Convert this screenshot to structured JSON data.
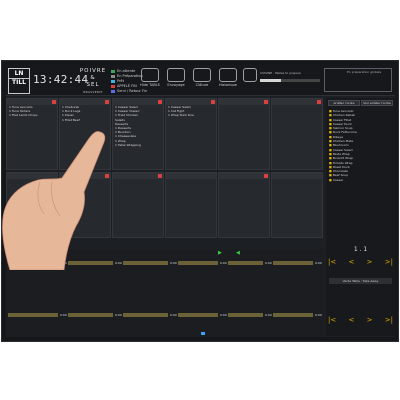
{
  "header": {
    "logo_top": "LN",
    "logo_bottom": "TILL",
    "clock": "13:42:44",
    "restaurant": [
      "POIVRE",
      "&",
      "SEL"
    ],
    "restaurant_sub": "BRASSERIE",
    "legend": [
      {
        "label": "En attente",
        "color": "#3aa757"
      },
      {
        "label": "En Préparation",
        "color": "#8a8a8a"
      },
      {
        "label": "Prêt",
        "color": "#3fb0e0"
      },
      {
        "label": "APPELÉ FIN",
        "color": "#d94040"
      },
      {
        "label": "Servi / Retour Fin",
        "color": "#5a6df0"
      }
    ],
    "tools": [
      "Hide TABLE",
      "Envoyage",
      "Clôture",
      "Historique",
      "Gestion des plats"
    ],
    "current_label": "CUISINE",
    "progress_caption": "Tables to prepare",
    "progress": 0.35,
    "box_caption": "En préparation globale"
  },
  "tiles": [
    {
      "lines": [
        "1 Tuna Avocado",
        "1 Tuna Tartare",
        "1 Filet Lamb Chops"
      ]
    },
    {
      "lines": [
        "1 Cheburek",
        "1 Duck Legs",
        "1 Kissel",
        "1 Fillet Beef"
      ]
    },
    {
      "lines": [
        "1 Caesar Salad",
        "1 Caesar Classic",
        "1 Fried Chicken",
        "Salads",
        "Desserts",
        "1 Desserts",
        "1 Bourbon",
        "1 Cheesecake",
        "1 Wrap",
        "1 Table Wrapping"
      ]
    },
    {
      "lines": [
        "1 Caesar Salad",
        "1 Cat Fight",
        "1 Wrap Stick Doe"
      ]
    },
    {
      "lines": []
    },
    {
      "lines": []
    }
  ],
  "right_panel": {
    "btn_left": "Arrêter l'ordre",
    "btn_right": "Voir arrêter l'ordre",
    "items": [
      "Tuna Avocado",
      "Chicken Kebab",
      "Caesar Fillet",
      "Caesar Duck",
      "Salmon Soup",
      "Duck Fettuccine",
      "Ribeye",
      "Chicken Plate",
      "Mushroom",
      "Caesar Salad",
      "Pasta Wrap",
      "Borscht Wrap",
      "Tomato Wrap",
      "Roast Duck",
      "Chocolate",
      "Beef Soup",
      "Caesar"
    ],
    "page_label": "1 . 1",
    "arrow_left": "|<",
    "arrow_prev": "<",
    "arrow_next": ">",
    "arrow_right": ">|",
    "bottom_bar": "Vente Table : Take Away"
  },
  "take_away": {
    "title": "Take Away",
    "times": [
      "0:00",
      "0:00",
      "0:00",
      "0:00",
      "0:00",
      "0:00"
    ]
  }
}
